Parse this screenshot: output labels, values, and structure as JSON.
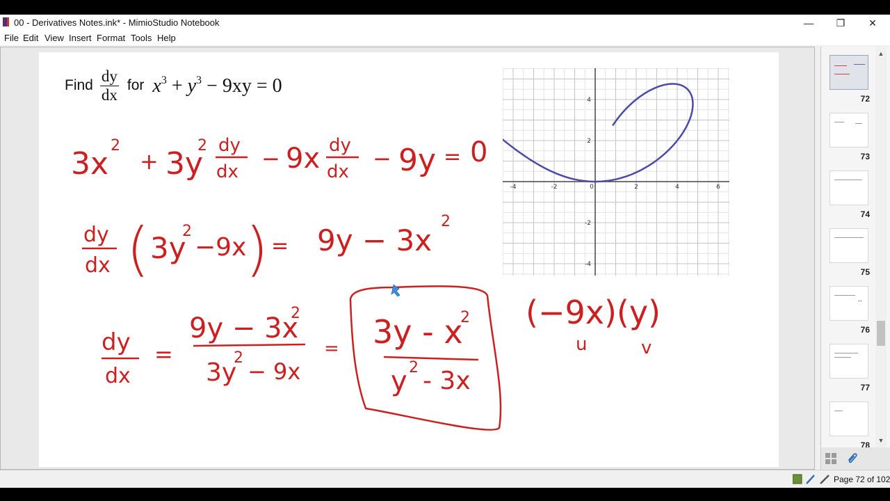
{
  "window": {
    "title": "00 - Derivatives Notes.ink* - MimioStudio Notebook",
    "controls": {
      "minimize": "—",
      "restore": "❐",
      "close": "✕"
    }
  },
  "menu": {
    "items": [
      "File",
      "Edit",
      "View",
      "Insert",
      "Format",
      "Tools",
      "Help"
    ]
  },
  "problem": {
    "prefix": "Find",
    "frac_num": "dy",
    "frac_den": "dx",
    "connector": "for",
    "equation": {
      "t1": "x",
      "e1": "3",
      "op1": " + ",
      "t2": "y",
      "e2": "3",
      "rest": " − 9xy = 0"
    }
  },
  "graph": {
    "x_ticks": [
      "-4",
      "-2",
      "0",
      "2",
      "4",
      "6"
    ],
    "y_ticks": [
      "4",
      "2",
      "-2",
      "-4"
    ],
    "curve_color": "#4a4aa8"
  },
  "handwriting": {
    "ink_color": "#cc1f1f",
    "line1": {
      "a": "3x",
      "a_sup": "2",
      "plus": "+",
      "b": "3y",
      "b_sup": "2",
      "d1_num": "dy",
      "d1_den": "dx",
      "minus1": "−",
      "c": "9x",
      "d2_num": "dy",
      "d2_den": "dx",
      "minus2": "−",
      "d": "9y",
      "eq": "=",
      "zero": "0"
    },
    "line2": {
      "dy": "dy",
      "dx": "dx",
      "lparen": "(",
      "inner": "3y",
      "inner_sup": "2",
      "inner_rest": "−9x",
      "rparen": ")",
      "eq": "=",
      "rhs": "9y − 3x",
      "rhs_sup": "2"
    },
    "line3": {
      "dy": "dy",
      "dx": "dx",
      "eq": "=",
      "num": "9y − 3x",
      "num_sup": "2",
      "den": "3y",
      "den_sup": "2",
      "den_rest": "− 9x",
      "eq2": "=",
      "boxed_num": "3y - x",
      "boxed_num_sup": "2",
      "boxed_den": "y",
      "boxed_den_sup": "2",
      "boxed_den_rest": "- 3x"
    }
  },
  "side_note": {
    "expr": "(−9x)(y)",
    "u": "u",
    "v": "v"
  },
  "thumbnails": [
    "72",
    "73",
    "74",
    "75",
    "76",
    "77",
    "78"
  ],
  "selected_page": "72",
  "status": {
    "page_indicator": "Page 72 of 102"
  }
}
